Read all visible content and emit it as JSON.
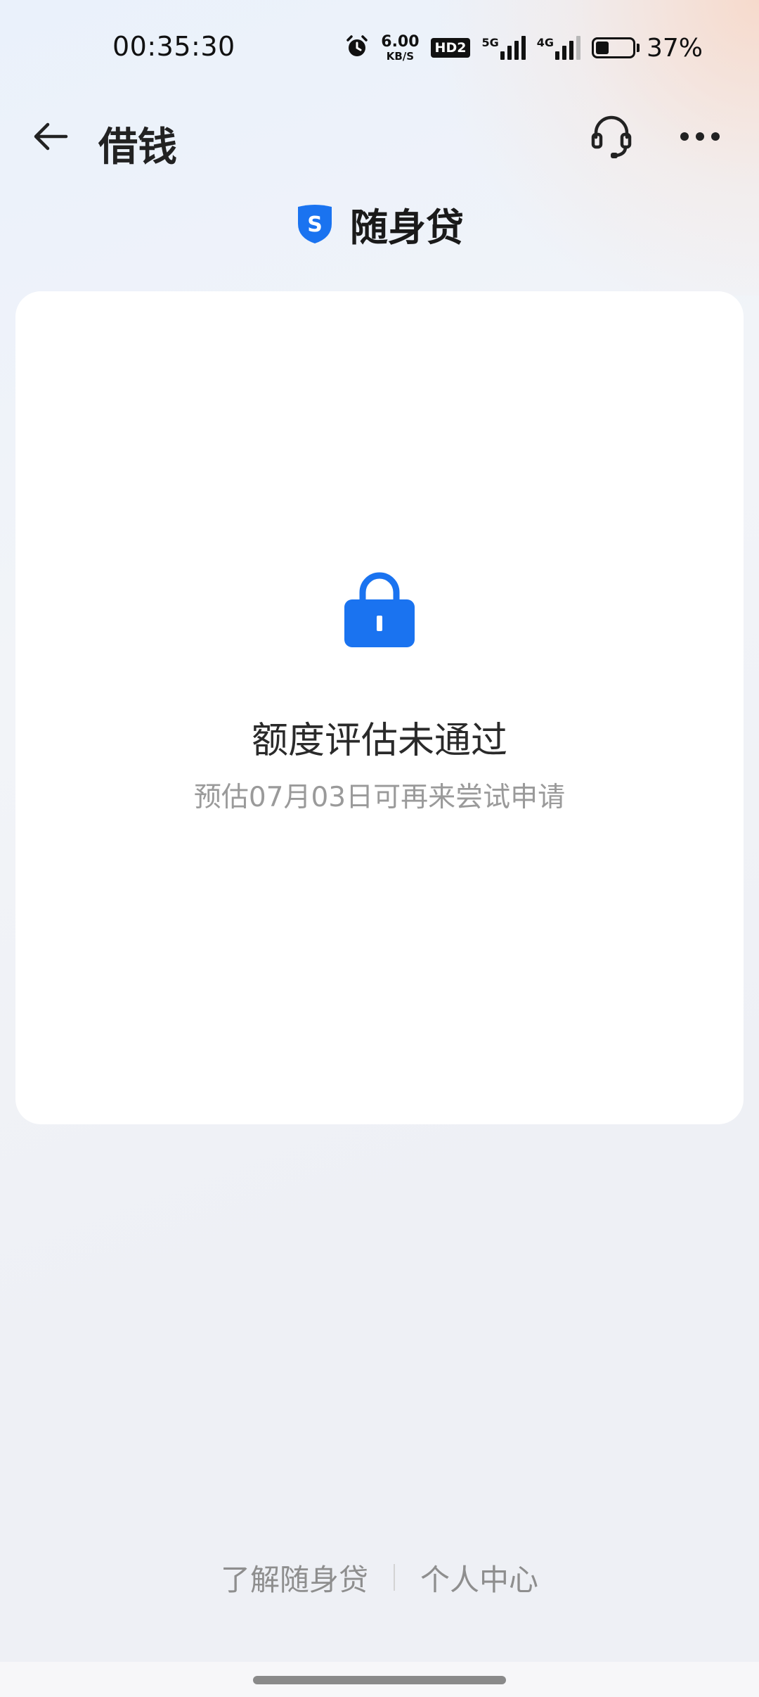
{
  "status_bar": {
    "time": "00:35:30",
    "net_speed_value": "6.00",
    "net_speed_unit": "KB/S",
    "hd_badge": "HD2",
    "signal_1_label": "5G",
    "signal_2_label": "4G",
    "battery_percent_text": "37%",
    "battery_level": 0.37
  },
  "header": {
    "title": "借钱",
    "icons": [
      "back-arrow-icon",
      "headset-icon",
      "more-icon"
    ]
  },
  "brand": {
    "logo_letter": "S",
    "name": "随身贷",
    "accent_color": "#1a73f0"
  },
  "card": {
    "icon": "lock-icon",
    "title": "额度评估未通过",
    "subtitle": "预估07月03日可再来尝试申请"
  },
  "footer": {
    "link_learn": "了解随身贷",
    "link_profile": "个人中心"
  }
}
